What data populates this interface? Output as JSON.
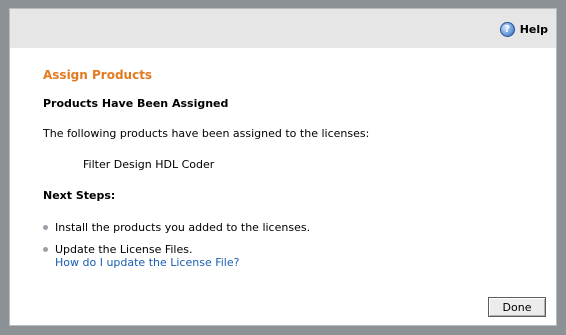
{
  "toolbar": {
    "help_label": "Help",
    "help_icon": "question-circle-icon"
  },
  "content": {
    "title": "Assign Products",
    "heading": "Products Have Been Assigned",
    "intro": "The following products have been assigned to the licenses:",
    "products": [
      "Filter Design HDL Coder"
    ],
    "next_steps_heading": "Next Steps:",
    "steps": [
      {
        "text": "Install the products you added to the licenses."
      },
      {
        "text": "Update the License Files.",
        "link": "How do I update the License File?"
      }
    ]
  },
  "footer": {
    "done_label": "Done"
  },
  "colors": {
    "title": "#e27a1f",
    "link": "#1a5fb4",
    "frame": "#8c9196",
    "topbar": "#e6e6e6"
  }
}
